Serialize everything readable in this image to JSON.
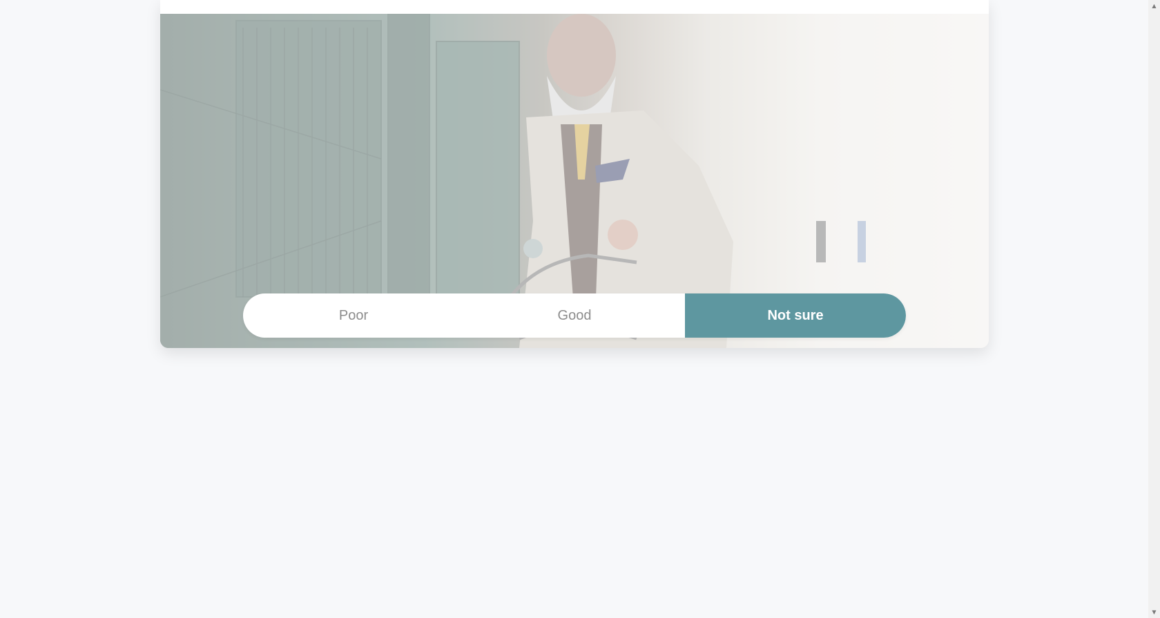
{
  "rating": {
    "options": [
      {
        "label": "Poor",
        "selected": false
      },
      {
        "label": "Good",
        "selected": false
      },
      {
        "label": "Not sure",
        "selected": true
      }
    ],
    "selected_color": "#5e97a0"
  },
  "hero": {
    "image_icon": "photo-man-with-bicycle"
  },
  "scrollbar": {
    "up_icon": "triangle-up-icon",
    "down_icon": "triangle-down-icon"
  }
}
